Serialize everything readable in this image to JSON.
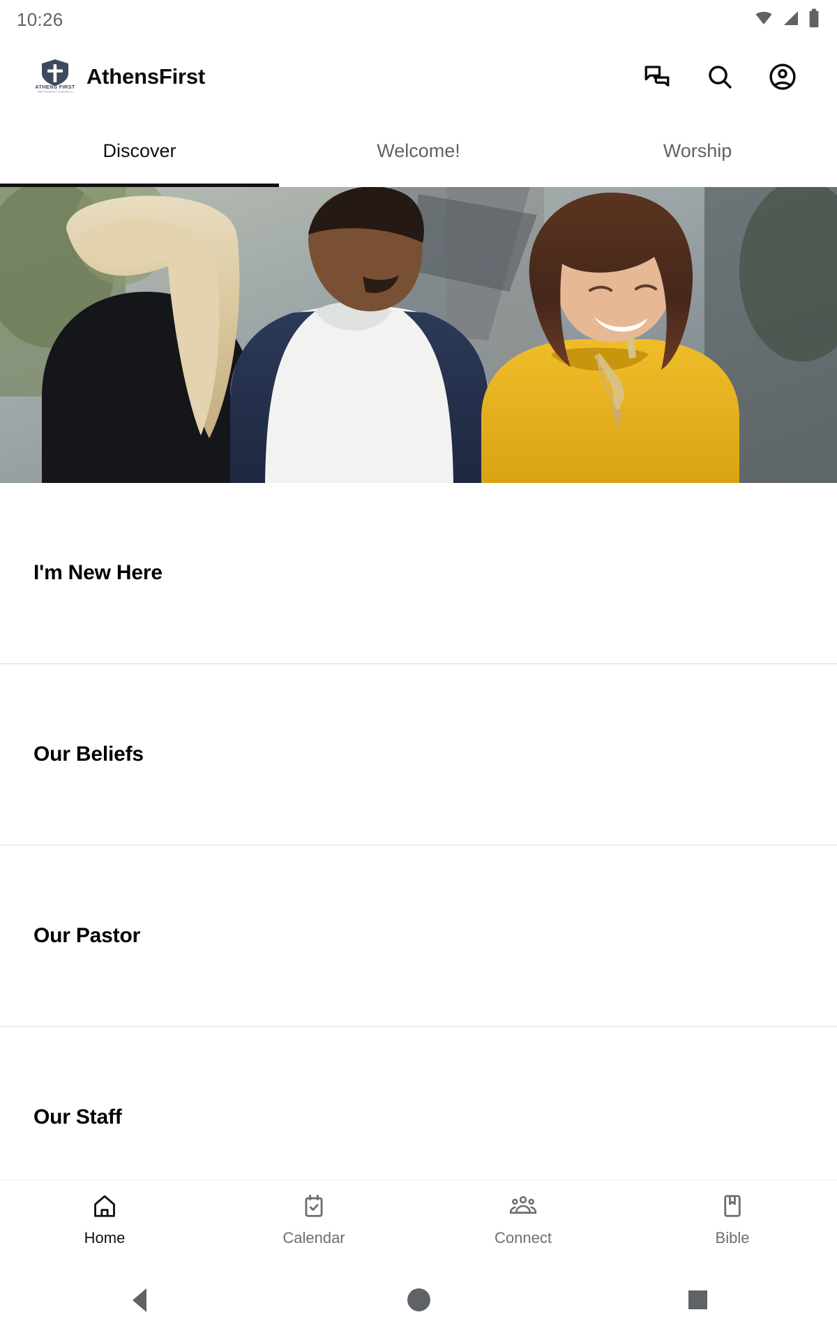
{
  "status_bar": {
    "time": "10:26",
    "icons": [
      "wifi-icon",
      "cellular-signal-icon",
      "battery-icon"
    ]
  },
  "app_bar": {
    "logo": {
      "name": "athensfirst-logo",
      "primary_text": "ATHENS FIRST",
      "secondary_text": "METHODIST CHURCH",
      "color": "#3d4a5c"
    },
    "title": "AthensFirst",
    "actions": [
      {
        "name": "chat-icon",
        "label": "Chat"
      },
      {
        "name": "search-icon",
        "label": "Search"
      },
      {
        "name": "account-circle-icon",
        "label": "Account"
      }
    ]
  },
  "tabs": {
    "active_index": 0,
    "items": [
      {
        "label": "Discover"
      },
      {
        "label": "Welcome!"
      },
      {
        "label": "Worship"
      }
    ]
  },
  "hero": {
    "name": "discover-hero-image",
    "alt": "Three young adults talking outdoors"
  },
  "list": {
    "items": [
      {
        "label": "I'm New Here"
      },
      {
        "label": "Our Beliefs"
      },
      {
        "label": "Our Pastor"
      },
      {
        "label": "Our Staff"
      }
    ]
  },
  "bottom_nav": {
    "active_index": 0,
    "items": [
      {
        "label": "Home",
        "icon": "home-icon"
      },
      {
        "label": "Calendar",
        "icon": "calendar-check-icon"
      },
      {
        "label": "Connect",
        "icon": "people-group-icon"
      },
      {
        "label": "Bible",
        "icon": "book-bookmark-icon"
      }
    ]
  },
  "system_nav": {
    "items": [
      {
        "name": "android-back-button"
      },
      {
        "name": "android-home-button"
      },
      {
        "name": "android-recents-button"
      }
    ]
  },
  "colors": {
    "accent": "#111111",
    "muted": "#5f6368",
    "divider": "#ececec",
    "logo_navy": "#3d4a5c"
  }
}
